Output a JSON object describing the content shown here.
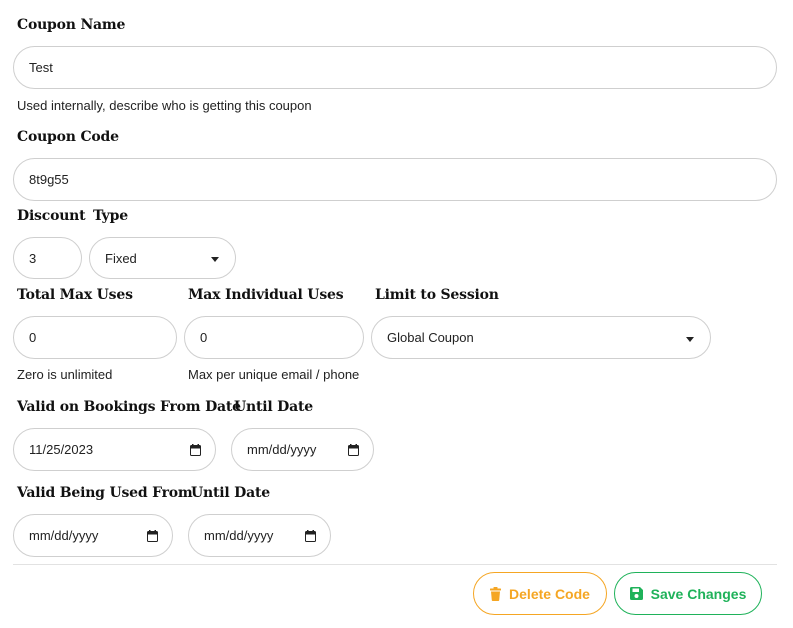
{
  "coupon_name": {
    "label": "Coupon Name",
    "value": "Test",
    "help": "Used internally, describe who is getting this coupon"
  },
  "coupon_code": {
    "label": "Coupon Code",
    "value": "8t9g55"
  },
  "discount": {
    "label": "Discount",
    "value": "3"
  },
  "type": {
    "label": "Type",
    "selected": "Fixed"
  },
  "total_max_uses": {
    "label": "Total Max Uses",
    "value": "0",
    "help": "Zero is unlimited"
  },
  "max_individual_uses": {
    "label": "Max Individual Uses",
    "value": "0",
    "help": "Max per unique email / phone"
  },
  "limit_to_session": {
    "label": "Limit to Session",
    "selected": "Global Coupon"
  },
  "valid_bookings_from": {
    "label": "Valid on Bookings From Date",
    "value": "11/25/2023"
  },
  "valid_bookings_until": {
    "label": "Until Date",
    "placeholder": "mm/dd/yyyy"
  },
  "valid_used_from": {
    "label": "Valid Being Used From",
    "placeholder": "mm/dd/yyyy"
  },
  "valid_used_until": {
    "label": "Until Date",
    "placeholder": "mm/dd/yyyy"
  },
  "actions": {
    "delete_label": "Delete Code",
    "save_label": "Save Changes",
    "delete_color": "#f5a623",
    "save_color": "#1fb25a",
    "delete_icon": "trash-icon",
    "save_icon": "floppy-disk-icon"
  }
}
